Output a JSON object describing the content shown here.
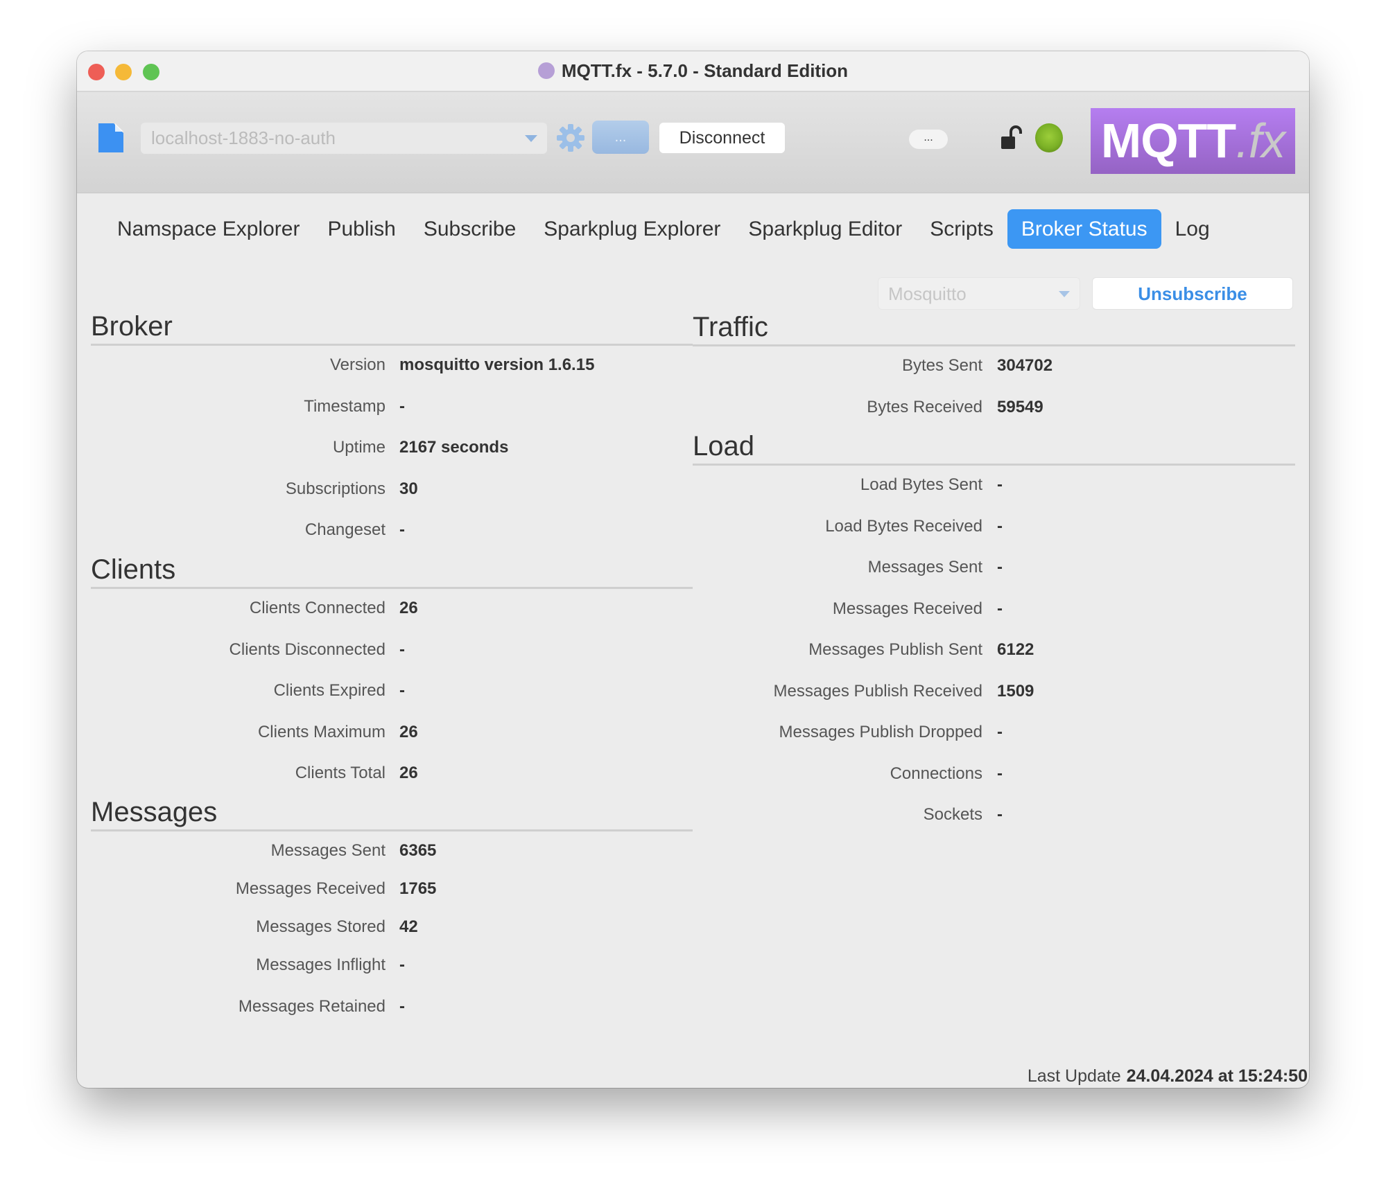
{
  "window": {
    "title": "MQTT.fx - 5.7.0 - Standard Edition"
  },
  "toolbar": {
    "connection_profile": "localhost-1883-no-auth",
    "dots_label": "...",
    "disconnect_label": "Disconnect",
    "more_label": "...",
    "logo_main": "MQTT",
    "logo_suffix": ".fx",
    "status_color": "#7bb126"
  },
  "tabs": [
    {
      "label": "Namspace Explorer",
      "active": false
    },
    {
      "label": "Publish",
      "active": false
    },
    {
      "label": "Subscribe",
      "active": false
    },
    {
      "label": "Sparkplug Explorer",
      "active": false
    },
    {
      "label": "Sparkplug Editor",
      "active": false
    },
    {
      "label": "Scripts",
      "active": false
    },
    {
      "label": "Broker Status",
      "active": true
    },
    {
      "label": "Log",
      "active": false
    }
  ],
  "controls": {
    "broker_type": "Mosquitto",
    "unsubscribe_label": "Unsubscribe"
  },
  "broker": {
    "title": "Broker",
    "rows": [
      {
        "label": "Version",
        "value": "mosquitto version 1.6.15"
      },
      {
        "label": "Timestamp",
        "value": "-"
      },
      {
        "label": "Uptime",
        "value": "2167 seconds"
      },
      {
        "label": "Subscriptions",
        "value": "30"
      },
      {
        "label": "Changeset",
        "value": "-"
      }
    ]
  },
  "clients": {
    "title": "Clients",
    "rows": [
      {
        "label": "Clients Connected",
        "value": "26"
      },
      {
        "label": "Clients Disconnected",
        "value": "-"
      },
      {
        "label": "Clients Expired",
        "value": "-"
      },
      {
        "label": "Clients Maximum",
        "value": "26"
      },
      {
        "label": "Clients Total",
        "value": "26"
      }
    ]
  },
  "messages": {
    "title": "Messages",
    "rows": [
      {
        "label": "Messages Sent",
        "value": "6365"
      },
      {
        "label": "Messages Received",
        "value": "1765"
      },
      {
        "label": "Messages Stored",
        "value": "42"
      },
      {
        "label": "Messages Inflight",
        "value": "-"
      },
      {
        "label": "Messages Retained",
        "value": "-"
      }
    ]
  },
  "traffic": {
    "title": "Traffic",
    "rows": [
      {
        "label": "Bytes Sent",
        "value": "304702"
      },
      {
        "label": "Bytes Received",
        "value": "59549"
      }
    ]
  },
  "load": {
    "title": "Load",
    "rows": [
      {
        "label": "Load Bytes Sent",
        "value": "-"
      },
      {
        "label": "Load Bytes Received",
        "value": "-"
      },
      {
        "label": "Messages Sent",
        "value": "-"
      },
      {
        "label": "Messages Received",
        "value": "-"
      },
      {
        "label": "Messages Publish Sent",
        "value": "6122"
      },
      {
        "label": "Messages Publish Received",
        "value": "1509"
      },
      {
        "label": "Messages Publish Dropped",
        "value": "-"
      },
      {
        "label": "Connections",
        "value": "-"
      },
      {
        "label": "Sockets",
        "value": "-"
      }
    ]
  },
  "footer": {
    "label": "Last Update",
    "timestamp": "24.04.2024 at 15:24:50"
  }
}
